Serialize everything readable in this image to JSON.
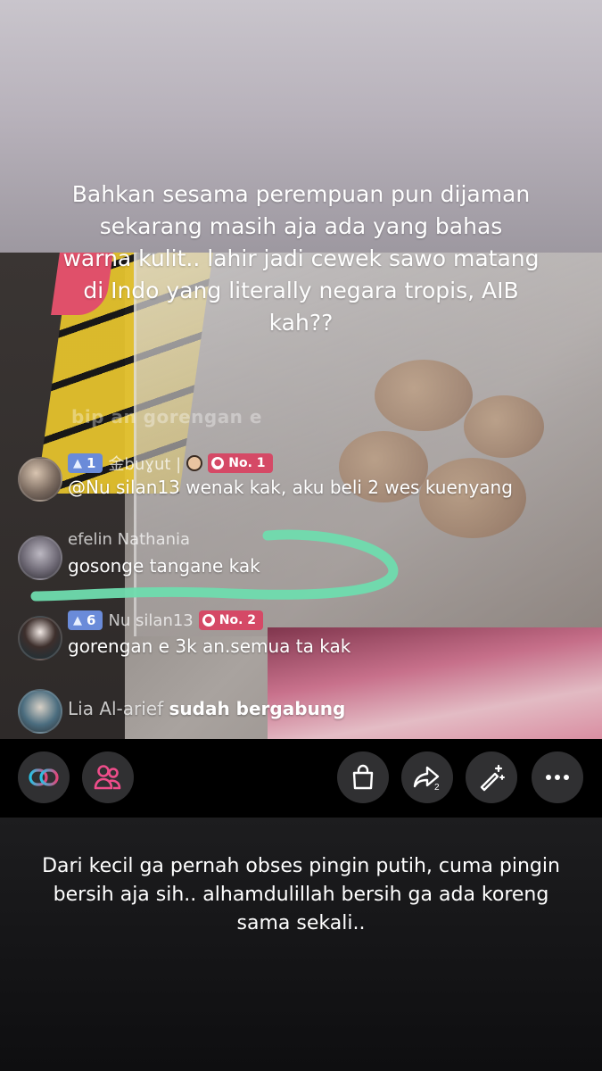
{
  "caption_top": "Bahkan sesama perempuan pun dijaman sekarang masih aja ada yang bahas warna kulit.. lahir jadi cewek sawo matang di Indo yang literally negara tropis, AIB kah??",
  "ghost_comment": "bip an gorengan e",
  "comments": [
    {
      "level": "1",
      "username": "金bսɣսt |",
      "rank": "No. 1",
      "text": "@Nu silan13 wenak kak, aku beli 2 wes kuenyang"
    },
    {
      "username": "efelin Nathania",
      "text": "gosonge tangane kak"
    },
    {
      "level": "6",
      "username": "Nu silan13",
      "rank": "No. 2",
      "text": "gorengan e 3k an.semua ta kak"
    },
    {
      "username": "Lia Al-arief",
      "joined": "sudah bergabung"
    }
  ],
  "action_bar": {
    "left": [
      "link-icon",
      "people-icon"
    ],
    "right": [
      "shopping-bag-icon",
      "share-icon",
      "magic-wand-icon",
      "more-icon"
    ],
    "share_count": "2"
  },
  "caption_bottom": "Dari kecil ga pernah obses pingin putih, cuma pingin bersih aja sih.. alhamdulillah bersih ga ada koreng sama sekali..",
  "colors": {
    "highlight_stroke": "#6fdcae",
    "level_badge": "#6a8bd9",
    "rank_badge": "#d54966",
    "link_icon_gradient": [
      "#27c3e6",
      "#e2477a"
    ],
    "people_icon": "#ee4d8a"
  }
}
